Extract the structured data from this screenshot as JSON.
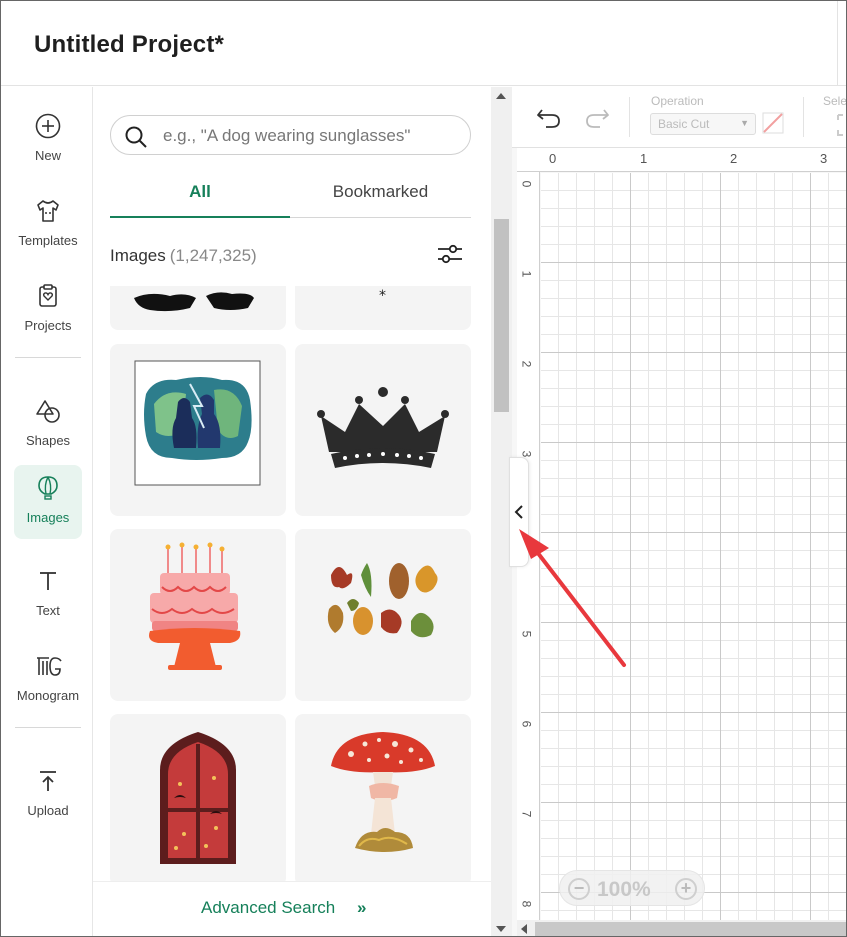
{
  "header": {
    "title": "Untitled Project*"
  },
  "nav": {
    "new": "New",
    "templates": "Templates",
    "projects": "Projects",
    "shapes": "Shapes",
    "images": "Images",
    "text": "Text",
    "monogram": "Monogram",
    "upload": "Upload"
  },
  "panel": {
    "search_placeholder": "e.g., \"A dog wearing sunglasses\"",
    "tabs": {
      "all": "All",
      "bookmarked": "Bookmarked"
    },
    "images_heading": "Images",
    "images_count": "(1,247,325)",
    "advanced_search": "Advanced Search",
    "advanced_search_icon": "»"
  },
  "toolbar": {
    "operation_label": "Operation",
    "operation_value": "Basic Cut",
    "select_label": "Sele"
  },
  "canvas": {
    "ruler_top": [
      "0",
      "1",
      "2",
      "3"
    ],
    "ruler_left": [
      "0",
      "1",
      "2",
      "3",
      "4",
      "5",
      "6",
      "7",
      "8"
    ],
    "zoom_level": "100%",
    "zoom_out": "−",
    "zoom_in": "+"
  },
  "colors": {
    "accent": "#16805a",
    "annotation_arrow": "#e8383d"
  }
}
